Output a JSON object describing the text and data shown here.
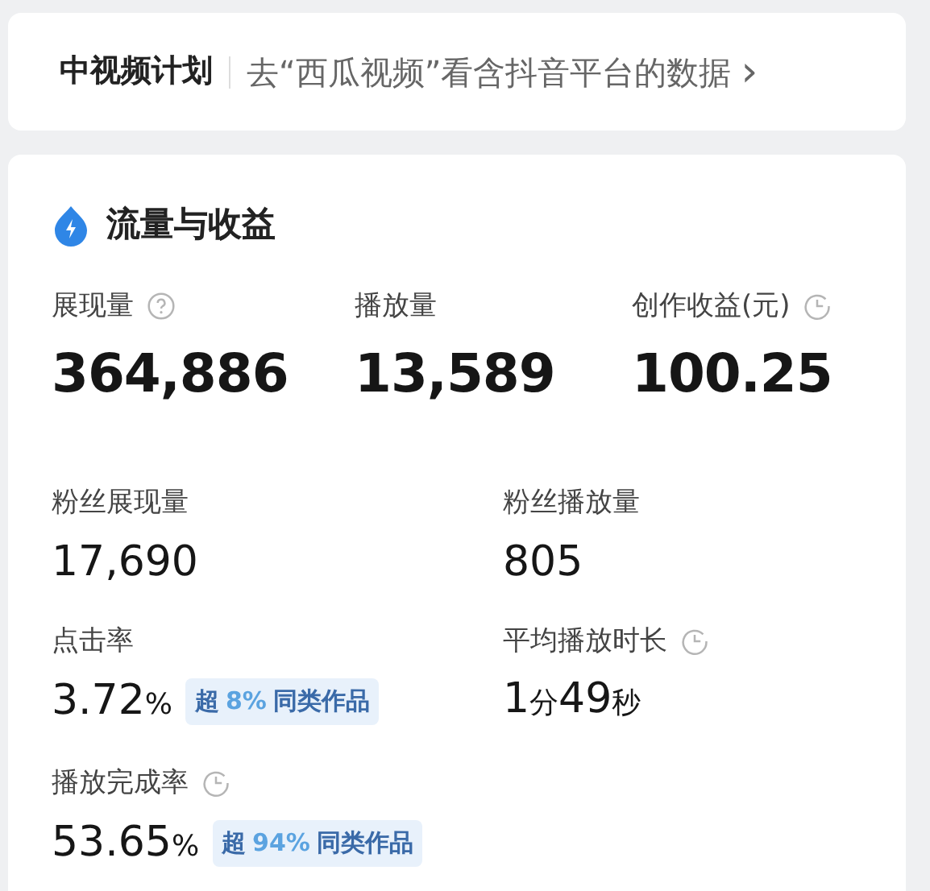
{
  "banner": {
    "title": "中视频计划",
    "link": "去“西瓜视频”看含抖音平台的数据",
    "chevron": "›"
  },
  "section": {
    "title": "流量与收益",
    "headline_metrics": [
      {
        "label": "展现量",
        "kind": "help",
        "value": "364,886"
      },
      {
        "label": "播放量",
        "kind": "plain",
        "value": "13,589"
      },
      {
        "label": "创作收益(元)",
        "kind": "timed",
        "value": "100.25"
      }
    ],
    "metrics": [
      {
        "label": "粉丝展现量",
        "kind": "plain",
        "value": [
          {
            "kind": "num",
            "text": "17,690"
          }
        ]
      },
      {
        "label": "粉丝播放量",
        "kind": "plain",
        "value": [
          {
            "kind": "num",
            "text": "805"
          }
        ]
      },
      {
        "label": "点击率",
        "kind": "plain",
        "value": [
          {
            "kind": "num",
            "text": "3.72"
          },
          {
            "kind": "unit",
            "text": "%"
          }
        ],
        "badge": {
          "prefix": "超",
          "percent": "8%",
          "suffix": "同类作品"
        }
      },
      {
        "label": "平均播放时长",
        "kind": "timed",
        "value": [
          {
            "kind": "num",
            "text": "1"
          },
          {
            "kind": "unit",
            "text": "分"
          },
          {
            "kind": "num",
            "text": "49"
          },
          {
            "kind": "unit",
            "text": "秒"
          }
        ]
      },
      {
        "label": "播放完成率",
        "kind": "timed",
        "value": [
          {
            "kind": "num",
            "text": "53.65"
          },
          {
            "kind": "unit",
            "text": "%"
          }
        ],
        "badge": {
          "prefix": "超",
          "percent": "94%",
          "suffix": "同类作品"
        }
      }
    ]
  }
}
